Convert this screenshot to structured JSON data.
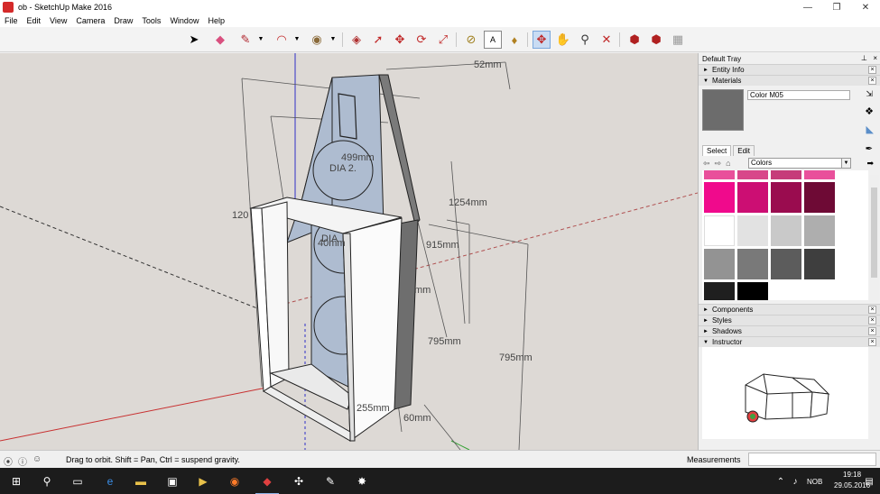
{
  "window": {
    "title": "ob - SketchUp Make 2016"
  },
  "menu": [
    "File",
    "Edit",
    "View",
    "Camera",
    "Draw",
    "Tools",
    "Window",
    "Help"
  ],
  "toolbar": {
    "tools": [
      {
        "name": "select-tool-icon",
        "glyph": "➤"
      },
      {
        "name": "eraser-tool-icon",
        "glyph": "◆"
      },
      {
        "name": "pencil-line-tool-icon",
        "glyph": "✎"
      },
      {
        "name": "arc-tool-icon",
        "glyph": "◠"
      },
      {
        "name": "shape-circle-tool-icon",
        "glyph": "◉"
      },
      {
        "name": "push-pull-tool-icon",
        "glyph": "◈"
      },
      {
        "name": "follow-me-tool-icon",
        "glyph": "➚"
      },
      {
        "name": "move-tool-icon",
        "glyph": "✥"
      },
      {
        "name": "rotate-tool-icon",
        "glyph": "⟳"
      },
      {
        "name": "scale-tool-icon",
        "glyph": "⤢"
      },
      {
        "name": "tape-measure-tool-icon",
        "glyph": "⊘"
      },
      {
        "name": "text-tool-icon",
        "glyph": "A"
      },
      {
        "name": "paint-bucket-tool-icon",
        "glyph": "🪣"
      },
      {
        "name": "orbit-tool-icon",
        "glyph": "✥"
      },
      {
        "name": "pan-tool-icon",
        "glyph": "✋"
      },
      {
        "name": "zoom-tool-icon",
        "glyph": "⚲"
      },
      {
        "name": "zoom-extents-tool-icon",
        "glyph": "✕"
      },
      {
        "name": "warehouse-icon",
        "glyph": "⬢"
      },
      {
        "name": "extension-warehouse-icon",
        "glyph": "⬢"
      },
      {
        "name": "layout-icon",
        "glyph": "▦"
      }
    ]
  },
  "viewport": {
    "dimensions": [
      {
        "id": "dim-top",
        "text": "52mm"
      },
      {
        "id": "dim-499",
        "text": "499mm"
      },
      {
        "id": "dim-dia2",
        "text": "DIA 2."
      },
      {
        "id": "dim-1254",
        "text": "1254mm"
      },
      {
        "id": "dim-120",
        "text": "120"
      },
      {
        "id": "dim-915",
        "text": "915mm"
      },
      {
        "id": "dim-dia",
        "text": "DIA"
      },
      {
        "id": "dim-40",
        "text": "40mm"
      },
      {
        "id": "dim-mm",
        "text": "mm"
      },
      {
        "id": "dim-795a",
        "text": "795mm"
      },
      {
        "id": "dim-795b",
        "text": "795mm"
      },
      {
        "id": "dim-255",
        "text": "255mm"
      },
      {
        "id": "dim-60",
        "text": "60mm"
      }
    ]
  },
  "tray": {
    "title": "Default Tray",
    "pin": "ᵖ",
    "close": "×",
    "panels_top": [
      {
        "label": "Entity Info",
        "expanded": false
      },
      {
        "label": "Materials",
        "expanded": true
      }
    ],
    "materials": {
      "current_name": "Color M05",
      "current_color": "#6c6c6c",
      "tabs": [
        "Select",
        "Edit"
      ],
      "collection": "Colors",
      "swatches": [
        "#e9509b",
        "#d8478a",
        "#c63c7a",
        "#e9509b",
        "#f00a8c",
        "#cc0e73",
        "#9a0c4f",
        "#6e0a35",
        "#ffffff",
        "#e2e2e2",
        "#c9c9c9",
        "#aeaeae",
        "#939393",
        "#797979",
        "#5c5c5c",
        "#3e3e3e",
        "#1f1f1f",
        "#000000"
      ]
    },
    "panels_bottom": [
      {
        "label": "Components"
      },
      {
        "label": "Styles"
      },
      {
        "label": "Shadows"
      },
      {
        "label": "Instructor",
        "expanded": true
      }
    ]
  },
  "status": {
    "message": "Drag to orbit.  Shift = Pan, Ctrl = suspend gravity.",
    "measurements_label": "Measurements",
    "measurements_value": ""
  },
  "taskbar": {
    "language": "NOB",
    "time": "19:18",
    "date": "29.05.2016"
  }
}
